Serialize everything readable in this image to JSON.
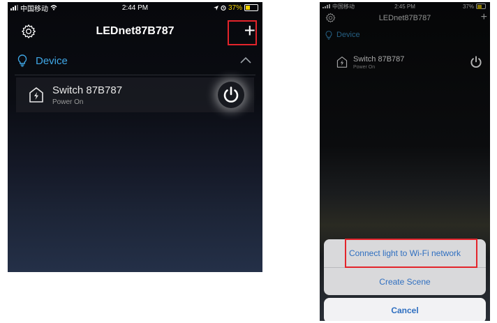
{
  "left_screen": {
    "status": {
      "carrier": "中国移动",
      "time": "2:44 PM",
      "battery": "37%"
    },
    "nav_title": "LEDnet87B787",
    "section_label": "Device",
    "device": {
      "name": "Switch 87B787",
      "status": "Power On"
    }
  },
  "right_screen": {
    "status": {
      "carrier": "中国移动",
      "time": "2:45 PM",
      "battery": "37%"
    },
    "nav_title": "LEDnet87B787",
    "section_label": "Device",
    "device": {
      "name": "Switch 87B787",
      "status": "Power On"
    },
    "action_sheet": {
      "items": [
        "Connect light to Wi-Fi network",
        "Create Scene"
      ],
      "cancel": "Cancel"
    }
  },
  "colors": {
    "accent": "#3fa7e6",
    "highlight": "#e3242b",
    "sheet_text": "#2f6fc0"
  }
}
